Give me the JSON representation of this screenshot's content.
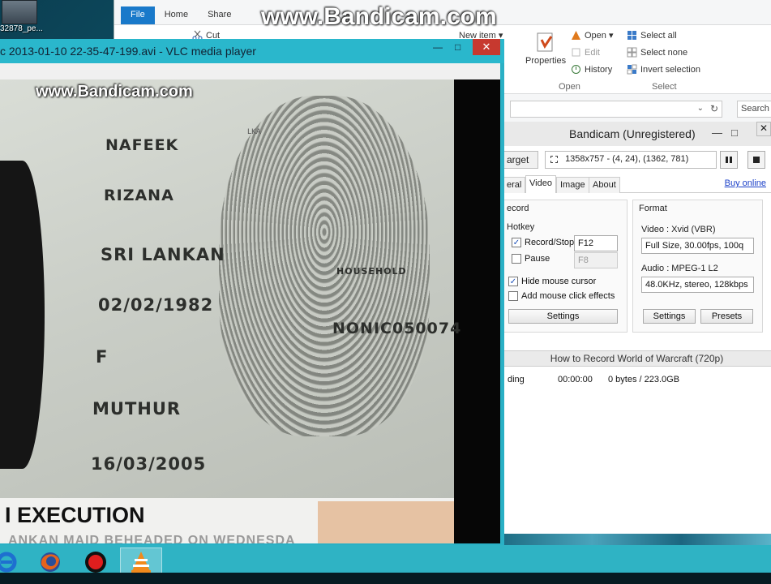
{
  "watermark": {
    "top": "www.Bandicam.com",
    "video": "www.Bandicam.com"
  },
  "desktop": {
    "icon_label": "32878_pe..."
  },
  "explorer": {
    "tabs": [
      "File",
      "Home",
      "Share"
    ],
    "cut_label": "Cut",
    "new_item_label": "New item ▾",
    "properties_label": "Properties",
    "open_label": "Open ▾",
    "edit_label": "Edit",
    "history_label": "History",
    "open_group_label": "Open",
    "select_all_label": "Select all",
    "select_none_label": "Select none",
    "invert_selection_label": "Invert selection",
    "select_group_label": "Select",
    "search_placeholder": "Search"
  },
  "vlc": {
    "title": "c 2013-01-10 22-35-47-199.avi - VLC media player",
    "minimize": "—",
    "maximize": "□",
    "close": "✕",
    "video": {
      "field_nafeek": "NAFEEK",
      "field_rizana": "RIZANA",
      "field_nationality": "SRI LANKAN",
      "field_dob": "02/02/1982",
      "field_sex": "F",
      "field_place": "MUTHUR",
      "field_issue_date": "16/03/2005",
      "field_passport_no": "NONIC050074",
      "field_household": "HOUSEHOLD",
      "field_lka": "LKA",
      "banner_title": "I EXECUTION",
      "banner_sub": "ANKAN MAID BEHEADED ON WEDNESDA"
    }
  },
  "bandicam": {
    "title": "Bandicam (Unregistered)",
    "target_label": "arget",
    "resolution_text": "1358x757 - (4, 24), (1362, 781)",
    "tabs": [
      "eral",
      "Video",
      "Image",
      "About"
    ],
    "buy_online": "Buy online",
    "record_title": "ecord",
    "hotkey_label": "Hotkey",
    "record_stop_label": "Record/Stop",
    "record_stop_key": "F12",
    "pause_label": "Pause",
    "pause_key": "F8",
    "hide_cursor_label": "Hide mouse cursor",
    "click_effects_label": "Add mouse click effects",
    "settings_label": "Settings",
    "format_title": "Format",
    "video_format_label": "Video : Xvid (VBR)",
    "video_format_value": "Full Size, 30.00fps, 100q",
    "audio_format_label": "Audio : MPEG-1 L2",
    "audio_format_value": "48.0KHz, stereo, 128kbps",
    "format_settings_label": "Settings",
    "presets_label": "Presets",
    "list_header": "How to Record World of Warcraft (720p)",
    "status_state": "ding",
    "status_time": "00:00:00",
    "status_size": "0 bytes / 223.0GB",
    "record_stop_checked": true,
    "pause_checked": false,
    "hide_cursor_checked": true,
    "click_effects_checked": false
  },
  "taskbar": {
    "items": [
      "ie-icon",
      "firefox-icon",
      "bandicam-record-icon",
      "vlc-icon"
    ],
    "active_item": "vlc-icon"
  },
  "colors": {
    "taskbar": "#2fb3c4",
    "vlc_title": "#2ab7cc",
    "close_button": "#c7392f",
    "explorer_file_tab": "#1979ca"
  }
}
